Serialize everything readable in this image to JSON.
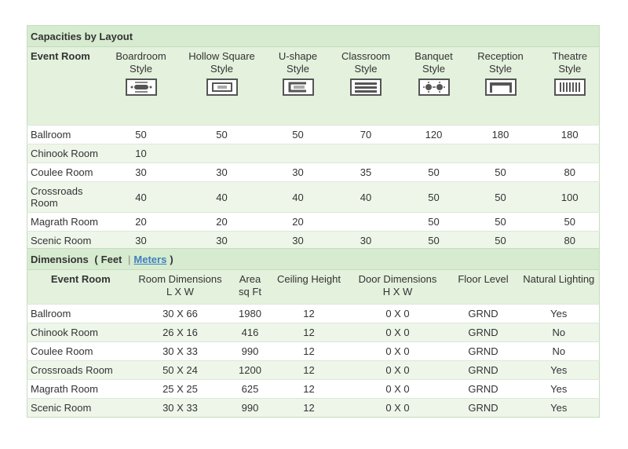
{
  "capacities": {
    "title": "Capacities by Layout",
    "first_header": "Event Room",
    "layouts": [
      {
        "label": "Boardroom\nStyle",
        "icon": "boardroom-layout-icon"
      },
      {
        "label": "Hollow Square\nStyle",
        "icon": "hollow-square-layout-icon"
      },
      {
        "label": "U-shape\nStyle",
        "icon": "u-shape-layout-icon"
      },
      {
        "label": "Classroom\nStyle",
        "icon": "classroom-layout-icon"
      },
      {
        "label": "Banquet\nStyle",
        "icon": "banquet-layout-icon"
      },
      {
        "label": "Reception\nStyle",
        "icon": "reception-layout-icon"
      },
      {
        "label": "Theatre\nStyle",
        "icon": "theatre-layout-icon"
      }
    ],
    "rows": [
      {
        "room": "Ballroom",
        "values": [
          "50",
          "50",
          "50",
          "70",
          "120",
          "180",
          "180"
        ]
      },
      {
        "room": "Chinook Room",
        "values": [
          "10",
          "",
          "",
          "",
          "",
          "",
          ""
        ]
      },
      {
        "room": "Coulee Room",
        "values": [
          "30",
          "30",
          "30",
          "35",
          "50",
          "50",
          "80"
        ]
      },
      {
        "room": "Crossroads\nRoom",
        "values": [
          "40",
          "40",
          "40",
          "40",
          "50",
          "50",
          "100"
        ]
      },
      {
        "room": "Magrath Room",
        "values": [
          "20",
          "20",
          "20",
          "",
          "50",
          "50",
          "50"
        ]
      },
      {
        "room": "Scenic Room",
        "values": [
          "30",
          "30",
          "30",
          "30",
          "50",
          "50",
          "80"
        ]
      }
    ]
  },
  "dimensions": {
    "title": "Dimensions",
    "paren_open": "(",
    "feet_label": "Feet",
    "separator": "|",
    "meters_label": "Meters",
    "paren_close": ")",
    "headers": [
      "Event Room",
      "Room Dimensions\nL X W",
      "Area\nsq Ft",
      "Ceiling Height",
      "Door Dimensions\nH X W",
      "Floor Level",
      "Natural Lighting"
    ],
    "rows": [
      [
        "Ballroom",
        "30 X 66",
        "1980",
        "12",
        "0 X 0",
        "GRND",
        "Yes"
      ],
      [
        "Chinook Room",
        "26 X 16",
        "416",
        "12",
        "0 X 0",
        "GRND",
        "No"
      ],
      [
        "Coulee Room",
        "30 X 33",
        "990",
        "12",
        "0 X 0",
        "GRND",
        "No"
      ],
      [
        "Crossroads Room",
        "50 X 24",
        "1200",
        "12",
        "0 X 0",
        "GRND",
        "Yes"
      ],
      [
        "Magrath Room",
        "25 X 25",
        "625",
        "12",
        "0 X 0",
        "GRND",
        "Yes"
      ],
      [
        "Scenic Room",
        "30 X 33",
        "990",
        "12",
        "0 X 0",
        "GRND",
        "Yes"
      ]
    ]
  },
  "colors": {
    "header_green": "#d6ebcf",
    "light_green": "#e3f1dd",
    "row_alt": "#eef6ea",
    "link_blue": "#3f7fbf"
  }
}
